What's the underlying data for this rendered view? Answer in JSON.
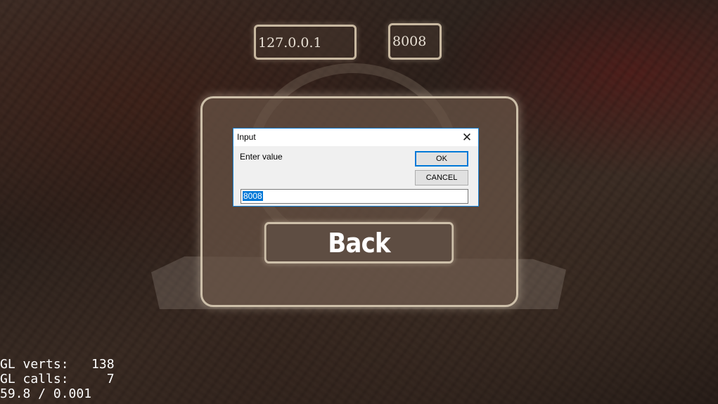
{
  "connect": {
    "ip_value": "127.0.0.1",
    "port_value": "8008"
  },
  "menu": {
    "back_label": "Back"
  },
  "dialog": {
    "title": "Input",
    "close_glyph": "✕",
    "prompt": "Enter value",
    "ok_label": "OK",
    "cancel_label": "CANCEL",
    "input_value": "8008"
  },
  "debug": {
    "line1": "GL verts:   138",
    "line2": "GL calls:     7",
    "line3": "59.8 / 0.001"
  },
  "colors": {
    "dialog_accent": "#0078d7",
    "panel_border": "#cdbfa9"
  }
}
